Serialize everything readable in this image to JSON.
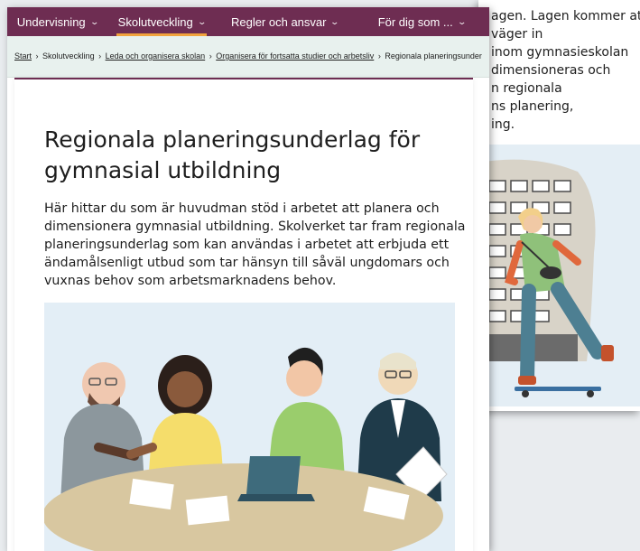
{
  "nav": {
    "items": [
      {
        "label": "Undervisning",
        "active": false
      },
      {
        "label": "Skolutveckling",
        "active": true
      },
      {
        "label": "Regler och ansvar",
        "active": false
      },
      {
        "label": "För dig som ...",
        "active": false
      }
    ],
    "chevron": "chevron-down-icon"
  },
  "breadcrumb": {
    "start": "Start",
    "sep": "›",
    "skolutveckling": "Skolutveckling",
    "leda": "Leda och organisera skolan",
    "organisera": "Organisera för fortsatta studier och arbetsliv",
    "current": "Regionala planeringsunder"
  },
  "article": {
    "title_lines": [
      "Regionala planeringsunderlag för",
      "gymnasial utbildning"
    ],
    "lead_lines": [
      "Här hittar du som är huvudman stöd i arbetet att planera och",
      "dimensionera gymnasial utbildning. Skolverket tar fram regionala",
      "planeringsunderlag som kan användas i arbetet att erbjuda ett",
      "ändamålsenligt utbud som tar hänsyn till såväl ungdomars och",
      "vuxnas behov som arbetsmarknadens behov."
    ]
  },
  "background_page": {
    "text_lines": [
      "agen. Lagen kommer att",
      " väger in",
      "inom gymnasieskolan",
      "dimensioneras och",
      "n regionala",
      "ns planering,",
      "ing."
    ]
  },
  "colors": {
    "brand": "#6e2d52",
    "accent": "#f1a33c",
    "breadcrumb_bg": "#e8f1ee",
    "illustration_bg": "#e3eef6"
  }
}
